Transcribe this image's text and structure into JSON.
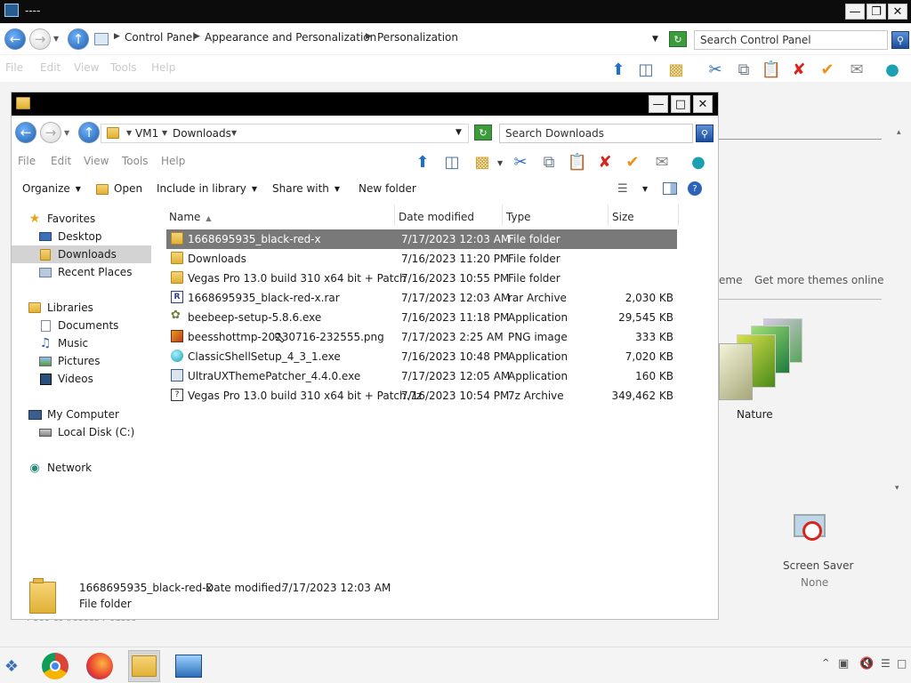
{
  "bg_window": {
    "title": "----",
    "breadcrumb": [
      "Control Panel",
      "Appearance and Personalization",
      "Personalization"
    ],
    "search_placeholder": "Search Control Panel",
    "ghost_menu": [
      "File",
      "Edit",
      "View",
      "Tools",
      "Help"
    ],
    "themes_link_partial": "eme",
    "get_more_themes": "Get more themes online",
    "theme_name": "Nature",
    "screen_saver_label": "Screen Saver",
    "screen_saver_value": "None",
    "partial_bottom_text": "Ease of Access Center"
  },
  "explorer": {
    "breadcrumb": [
      "VM1",
      "Downloads"
    ],
    "search_placeholder": "Search Downloads",
    "menu": [
      "File",
      "Edit",
      "View",
      "Tools",
      "Help"
    ],
    "commands": {
      "organize": "Organize",
      "open": "Open",
      "include": "Include in library",
      "share": "Share with",
      "new_folder": "New folder"
    },
    "nav": {
      "favorites": "Favorites",
      "desktop": "Desktop",
      "downloads": "Downloads",
      "recent": "Recent Places",
      "libraries": "Libraries",
      "documents": "Documents",
      "music": "Music",
      "pictures": "Pictures",
      "videos": "Videos",
      "computer": "My Computer",
      "local_disk": "Local Disk (C:)",
      "network": "Network"
    },
    "columns": {
      "name": "Name",
      "date": "Date modified",
      "type": "Type",
      "size": "Size"
    },
    "files": [
      {
        "name": "1668695935_black-red-x",
        "date": "7/17/2023 12:03 AM",
        "type": "File folder",
        "size": "",
        "icon": "folder-icon"
      },
      {
        "name": "Downloads",
        "date": "7/16/2023 11:20 PM",
        "type": "File folder",
        "size": "",
        "icon": "folder-icon"
      },
      {
        "name": "Vegas Pro 13.0 build 310 x64 bit + Patch",
        "date": "7/16/2023 10:55 PM",
        "type": "File folder",
        "size": "",
        "icon": "folder-icon"
      },
      {
        "name": "1668695935_black-red-x.rar",
        "date": "7/17/2023 12:03 AM",
        "type": "rar Archive",
        "size": "2,030 KB",
        "icon": "rar-icon"
      },
      {
        "name": "beebeep-setup-5.8.6.exe",
        "date": "7/16/2023 11:18 PM",
        "type": "Application",
        "size": "29,545 KB",
        "icon": "exe-icon"
      },
      {
        "name": "beesshottmp-20230716-232555.png",
        "date": "7/17/2023 2:25 AM",
        "type": "PNG image",
        "size": "333 KB",
        "icon": "image-icon"
      },
      {
        "name": "ClassicShellSetup_4_3_1.exe",
        "date": "7/16/2023 10:48 PM",
        "type": "Application",
        "size": "7,020 KB",
        "icon": "shell-icon"
      },
      {
        "name": "UltraUXThemePatcher_4.4.0.exe",
        "date": "7/17/2023 12:05 AM",
        "type": "Application",
        "size": "160 KB",
        "icon": "app-icon"
      },
      {
        "name": "Vegas Pro 13.0 build 310 x64 bit + Patch.7z",
        "date": "7/16/2023 10:54 PM",
        "type": "7z Archive",
        "size": "349,462 KB",
        "icon": "archive-icon"
      }
    ],
    "details": {
      "name": "1668695935_black-red-x",
      "date_label": "Date modified:",
      "date_value": "7/17/2023 12:03 AM",
      "type": "File folder"
    }
  }
}
